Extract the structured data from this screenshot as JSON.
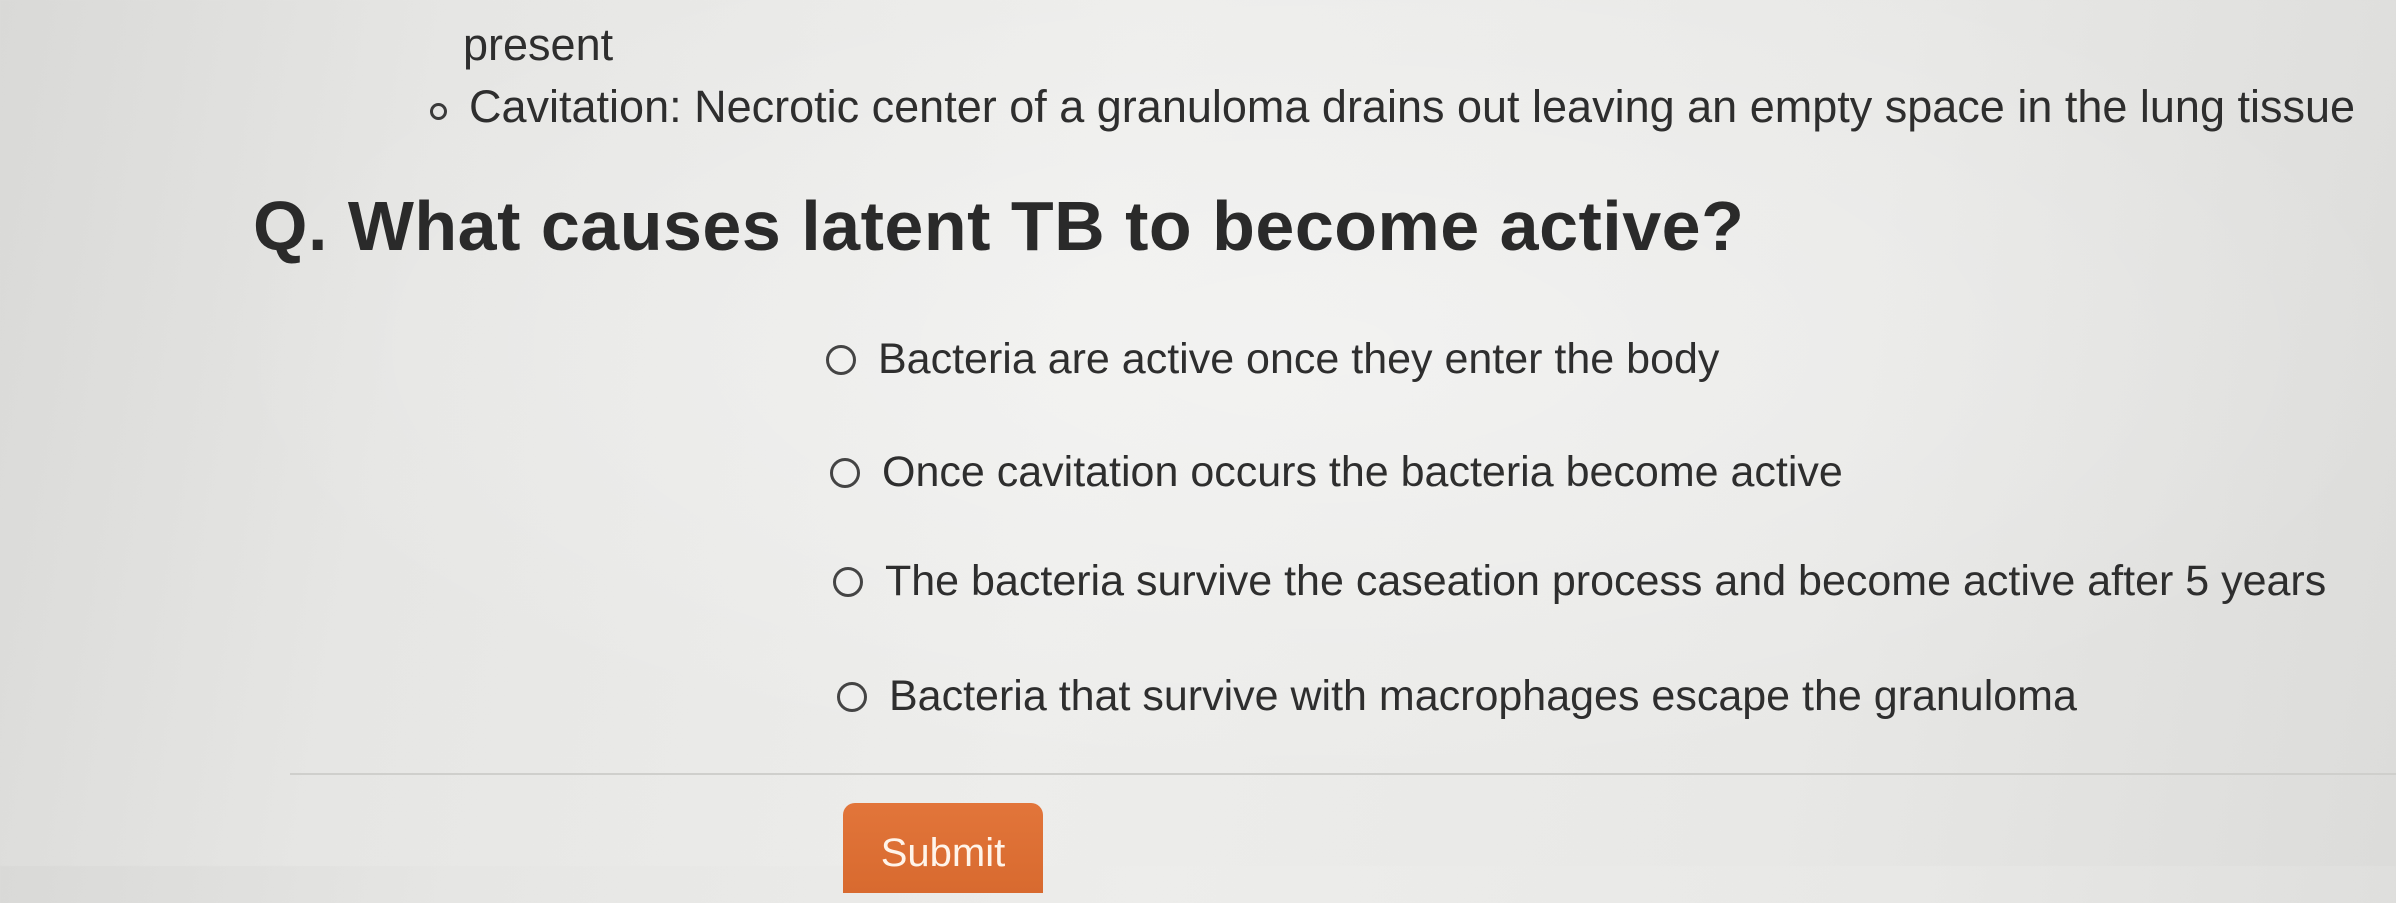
{
  "content": {
    "continuation_text": "present",
    "bullet": {
      "text": "Cavitation: Necrotic center of a granuloma drains out leaving an empty space in the lung tissue"
    }
  },
  "quiz": {
    "question": "Q. What causes latent TB to become active?",
    "options": [
      {
        "label": "Bacteria are active once they enter the body",
        "selected": false
      },
      {
        "label": "Once cavitation occurs the bacteria become active",
        "selected": false
      },
      {
        "label": "The bacteria survive the caseation process and become active after 5 years",
        "selected": false
      },
      {
        "label": "Bacteria that survive with macrophages escape the granuloma",
        "selected": false
      }
    ],
    "submit_label": "Submit"
  },
  "colors": {
    "submit_button": "#d86a2f",
    "text": "#2e2e2e",
    "background": "#e9e9e7"
  }
}
